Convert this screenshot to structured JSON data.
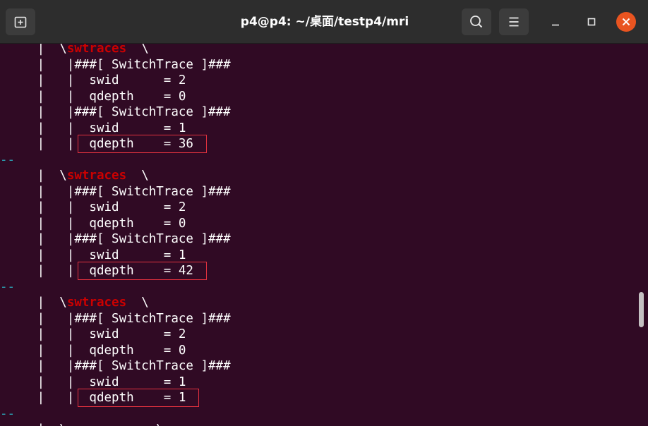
{
  "window": {
    "title": "p4@p4: ~/桌面/testp4/mri"
  },
  "titlebar": {
    "icons": {
      "new_tab": "new-tab-icon",
      "search": "search-icon",
      "menu": "hamburger-menu-icon",
      "minimize": "minimize-icon",
      "maximize": "maximize-icon",
      "close": "close-icon"
    }
  },
  "colors": {
    "terminal_bg": "#300a24",
    "titlebar_bg": "#2d2d2d",
    "keyword": "#cc0000",
    "separator": "#2aa1b3",
    "close_button": "#e95420",
    "highlight_box": "#e3323f"
  },
  "terminal": {
    "lines": [
      {
        "pre": "     |  \\",
        "kw": "swtraces",
        "post": "  \\"
      },
      {
        "pre": "     |   |###[ SwitchTrace ]###"
      },
      {
        "pre": "     |   |  swid      = 2"
      },
      {
        "pre": "     |   |  qdepth    = 0"
      },
      {
        "pre": "     |   |###[ SwitchTrace ]###"
      },
      {
        "pre": "     |   |  swid      = 1"
      },
      {
        "pre": "     |   |  qdepth    = 36"
      },
      {
        "sep": "--"
      },
      {
        "pre": "     |  \\",
        "kw": "swtraces",
        "post": "  \\"
      },
      {
        "pre": "     |   |###[ SwitchTrace ]###"
      },
      {
        "pre": "     |   |  swid      = 2"
      },
      {
        "pre": "     |   |  qdepth    = 0"
      },
      {
        "pre": "     |   |###[ SwitchTrace ]###"
      },
      {
        "pre": "     |   |  swid      = 1"
      },
      {
        "pre": "     |   |  qdepth    = 42"
      },
      {
        "sep": "--"
      },
      {
        "pre": "     |  \\",
        "kw": "swtraces",
        "post": "  \\"
      },
      {
        "pre": "     |   |###[ SwitchTrace ]###"
      },
      {
        "pre": "     |   |  swid      = 2"
      },
      {
        "pre": "     |   |  qdepth    = 0"
      },
      {
        "pre": "     |   |###[ SwitchTrace ]###"
      },
      {
        "pre": "     |   |  swid      = 1"
      },
      {
        "pre": "     |   |  qdepth    = 1"
      },
      {
        "sep": "--"
      },
      {
        "pre": "     |  \\            \\"
      }
    ],
    "highlighted_lines": [
      6,
      14,
      22
    ]
  }
}
